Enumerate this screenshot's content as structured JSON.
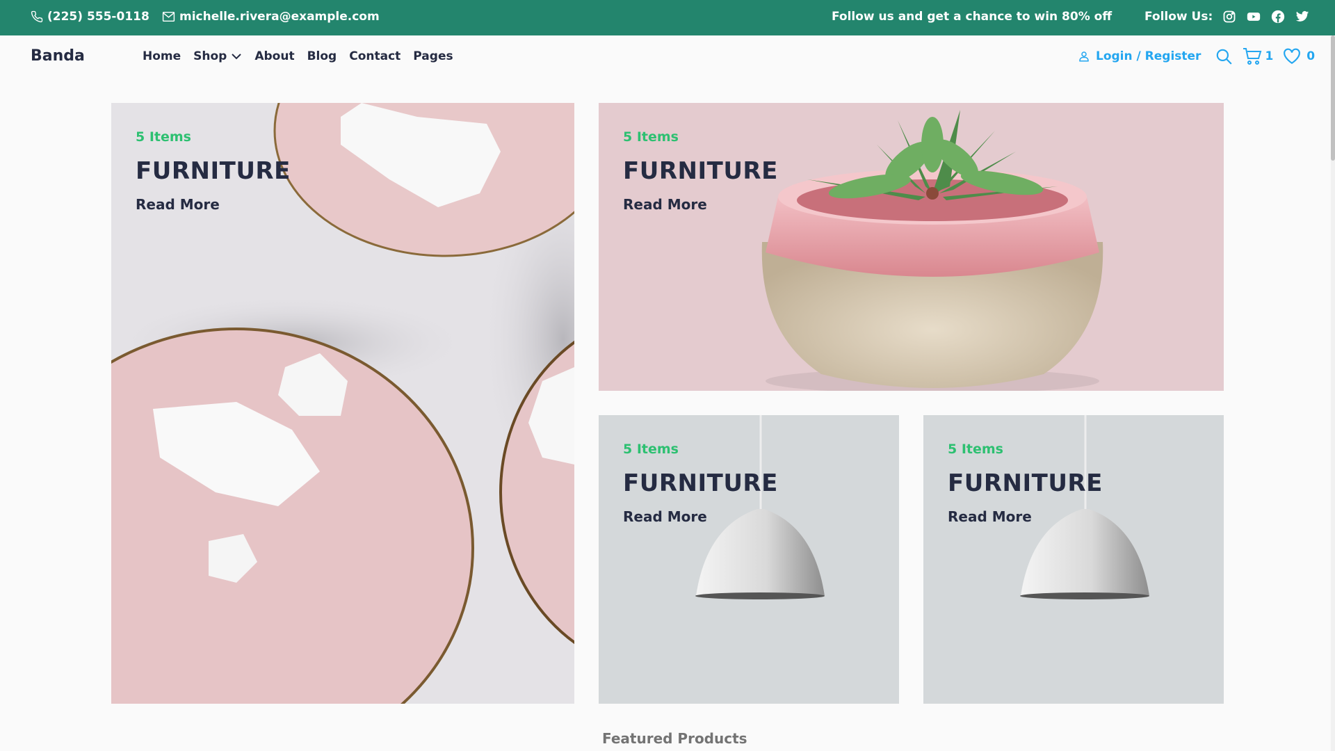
{
  "topbar": {
    "phone": "(225) 555-0118",
    "email": "michelle.rivera@example.com",
    "promo": "Follow us and get a chance to win 80% off",
    "follow_label": "Follow Us:",
    "social_icons": [
      "instagram-icon",
      "youtube-icon",
      "facebook-icon",
      "twitter-icon"
    ],
    "bg_color": "#23856D"
  },
  "nav": {
    "brand": "Banda",
    "menu": [
      "Home",
      "Shop",
      "About",
      "Blog",
      "Contact",
      "Pages"
    ],
    "login": "Login / Register",
    "cart_count": "1",
    "wishlist_count": "0",
    "accent_color": "#23A6F0"
  },
  "cards": [
    {
      "items": "5 Items",
      "title": "FURNITURE",
      "cta": "Read More"
    },
    {
      "items": "5 Items",
      "title": "FURNITURE",
      "cta": "Read More"
    },
    {
      "items": "5 Items",
      "title": "FURNITURE",
      "cta": "Read More"
    },
    {
      "items": "5 Items",
      "title": "FURNITURE",
      "cta": "Read More"
    }
  ],
  "featured": "Featured Products"
}
